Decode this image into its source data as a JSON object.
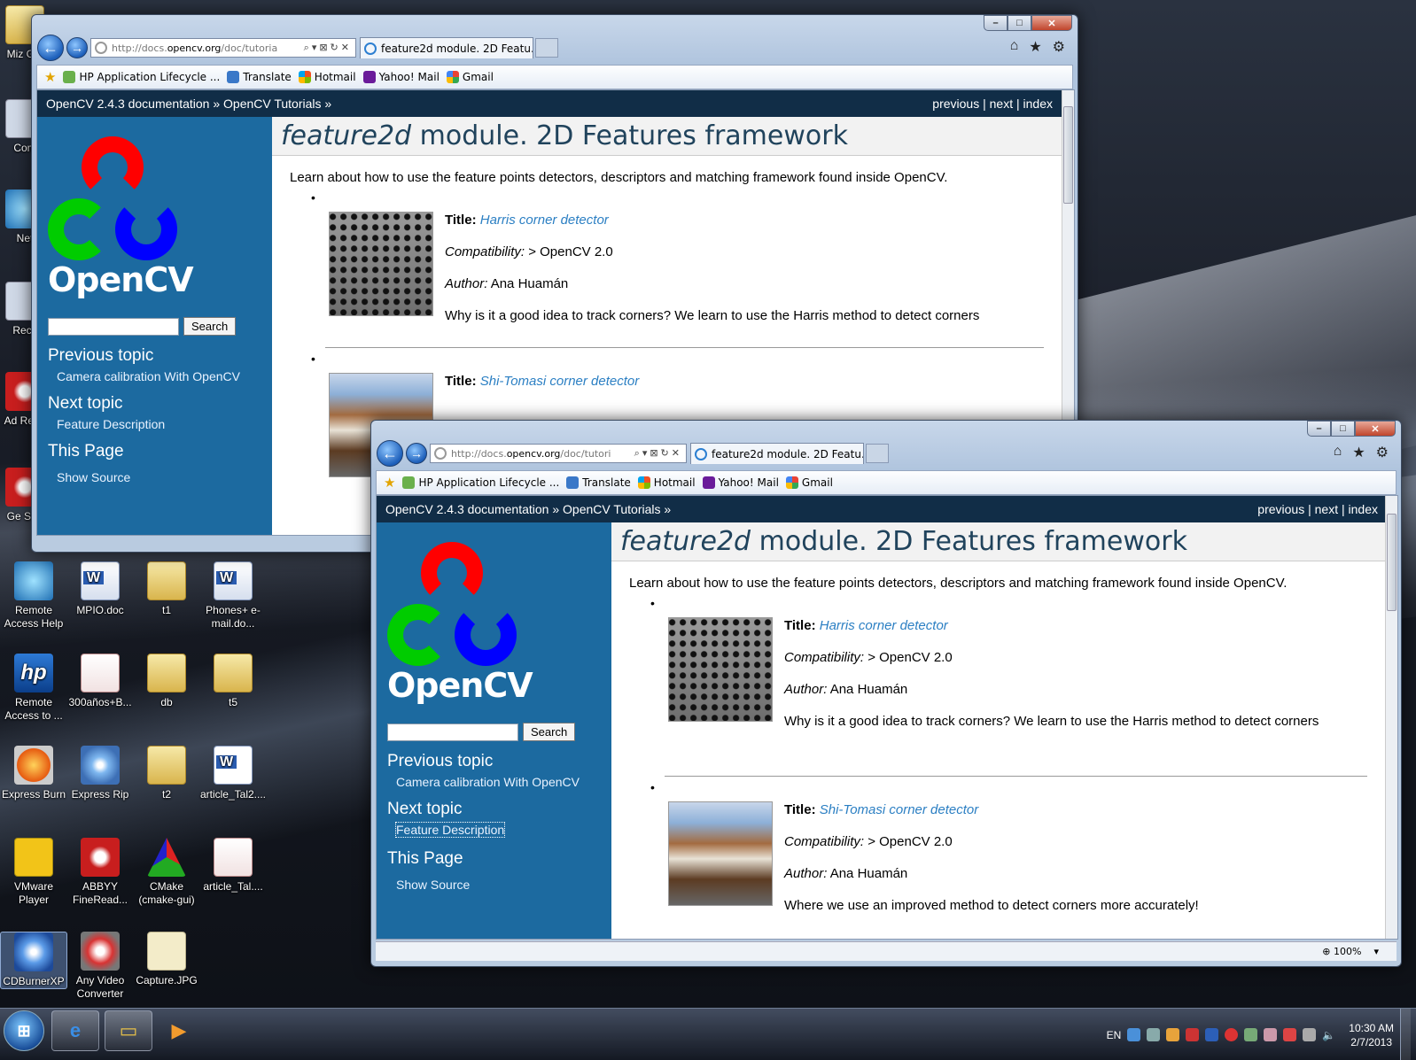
{
  "desktop": {
    "icons": [
      {
        "label": "Miz Gal",
        "icon": "folder-icon"
      },
      {
        "label": "Com",
        "icon": "computer-icon"
      },
      {
        "label": "Net",
        "icon": "network-icon"
      },
      {
        "label": "Recy",
        "icon": "recycle-bin-icon"
      },
      {
        "label": "Ad Read",
        "icon": "adobe-reader-icon"
      },
      {
        "label": "Ge Sup",
        "icon": "support-icon"
      },
      {
        "label": "Remote Access Help",
        "icon": "remote-access-help-icon"
      },
      {
        "label": "MPIO.doc",
        "icon": "word-document-icon"
      },
      {
        "label": "t1",
        "icon": "folder-icon"
      },
      {
        "label": "Phones+ e-mail.do...",
        "icon": "word-document-icon"
      },
      {
        "label": "Remote Access to ...",
        "icon": "hp-remote-access-icon"
      },
      {
        "label": "300años+B...",
        "icon": "pdf-document-icon"
      },
      {
        "label": "db",
        "icon": "folder-icon"
      },
      {
        "label": "t5",
        "icon": "folder-icon"
      },
      {
        "label": "Express Burn",
        "icon": "express-burn-icon"
      },
      {
        "label": "Express Rip",
        "icon": "express-rip-icon"
      },
      {
        "label": "t2",
        "icon": "folder-icon"
      },
      {
        "label": "article_Tal2....",
        "icon": "document-icon"
      },
      {
        "label": "VMware Player",
        "icon": "vmware-player-icon"
      },
      {
        "label": "ABBYY FineRead...",
        "icon": "abbyy-finereader-icon"
      },
      {
        "label": "CMake (cmake-gui)",
        "icon": "cmake-icon"
      },
      {
        "label": "article_Tal....",
        "icon": "document-icon"
      },
      {
        "label": "CDBurnerXP",
        "icon": "cdburnerxp-icon"
      },
      {
        "label": "Any Video Converter",
        "icon": "any-video-converter-icon"
      },
      {
        "label": "Capture.JPG",
        "icon": "image-file-icon"
      }
    ]
  },
  "browser": {
    "address_prefix": "http://docs.",
    "address_domain": "opencv.org",
    "address_path_back": "/doc/tutoria",
    "address_path_front": "/doc/tutori",
    "tab_title": "feature2d module. 2D Featu...",
    "favorites": [
      "HP Application Lifecycle ...",
      "Translate",
      "Hotmail",
      "Yahoo! Mail",
      "Gmail"
    ],
    "zoom": "100%"
  },
  "page": {
    "breadcrumb": "OpenCV 2.4.3 documentation » OpenCV Tutorials »",
    "relnav": {
      "previous": "previous",
      "next": "next",
      "index": "index",
      "sep": "|"
    },
    "logo_text": "OpenCV",
    "search_button": "Search",
    "sidebar": {
      "previous_heading": "Previous topic",
      "previous_link": "Camera calibration With OpenCV",
      "next_heading": "Next topic",
      "next_link": "Feature Description",
      "this_page_heading": "This Page",
      "show_source": "Show Source"
    },
    "title_em": "feature2d",
    "title_rest": " module. 2D Features framework",
    "intro": "Learn about how to use the feature points detectors, descriptors and matching framework found inside OpenCV.",
    "labels": {
      "title": "Title:",
      "compat": "Compatibility:",
      "author": "Author:"
    },
    "tutorials": [
      {
        "title": "Harris corner detector",
        "compatibility": " > OpenCV 2.0",
        "author": " Ana Huamán",
        "description": "Why is it a good idea to track corners? We learn to use the Harris method to detect corners"
      },
      {
        "title": "Shi-Tomasi corner detector",
        "compatibility": " > OpenCV 2.0",
        "author": " Ana Huamán",
        "description": "Where we use an improved method to detect corners more accurately!"
      }
    ]
  },
  "taskbar": {
    "language": "EN",
    "time": "10:30 AM",
    "date": "2/7/2013"
  }
}
